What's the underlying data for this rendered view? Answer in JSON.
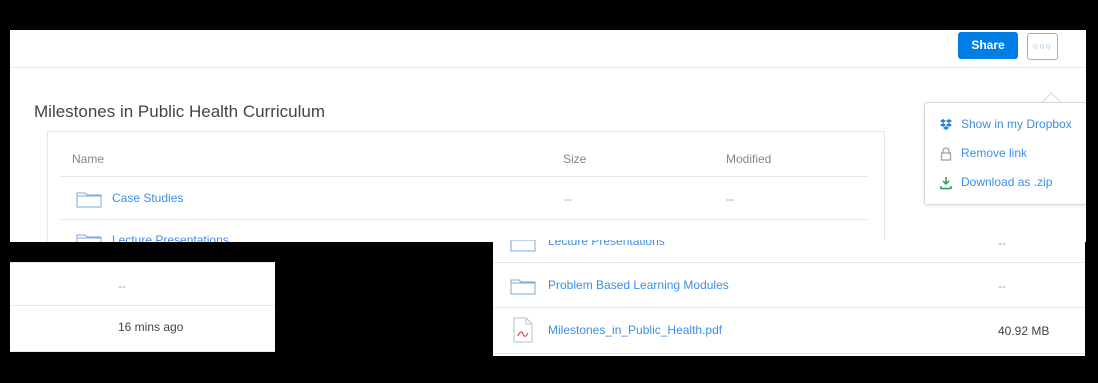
{
  "toolbar": {
    "share_label": "Share",
    "more_label": "○○○"
  },
  "folder": {
    "title": "Milestones in Public Health Curriculum"
  },
  "table": {
    "headers": {
      "name": "Name",
      "size": "Size",
      "modified": "Modified"
    },
    "rows": [
      {
        "name": "Case Studies",
        "size": "--",
        "modified": "--"
      },
      {
        "name": "Lecture Presentations"
      }
    ]
  },
  "menu": {
    "items": [
      {
        "label": "Show in my Dropbox",
        "icon": "dropbox-icon"
      },
      {
        "label": "Remove link",
        "icon": "lock-icon"
      },
      {
        "label": "Download as .zip",
        "icon": "download-icon"
      }
    ]
  },
  "fragment_left": {
    "rows": [
      {
        "modified": "--"
      },
      {
        "modified": "16 mins ago"
      }
    ]
  },
  "fragment_right": {
    "rows": [
      {
        "name": "Lecture Presentations",
        "size": "--"
      },
      {
        "name": "Problem Based Learning Modules",
        "size": "--"
      },
      {
        "name": "Milestones_in_Public_Health.pdf",
        "size": "40.92 MB"
      }
    ]
  },
  "colors": {
    "accent": "#007ee5",
    "link": "#3d8ee6"
  }
}
